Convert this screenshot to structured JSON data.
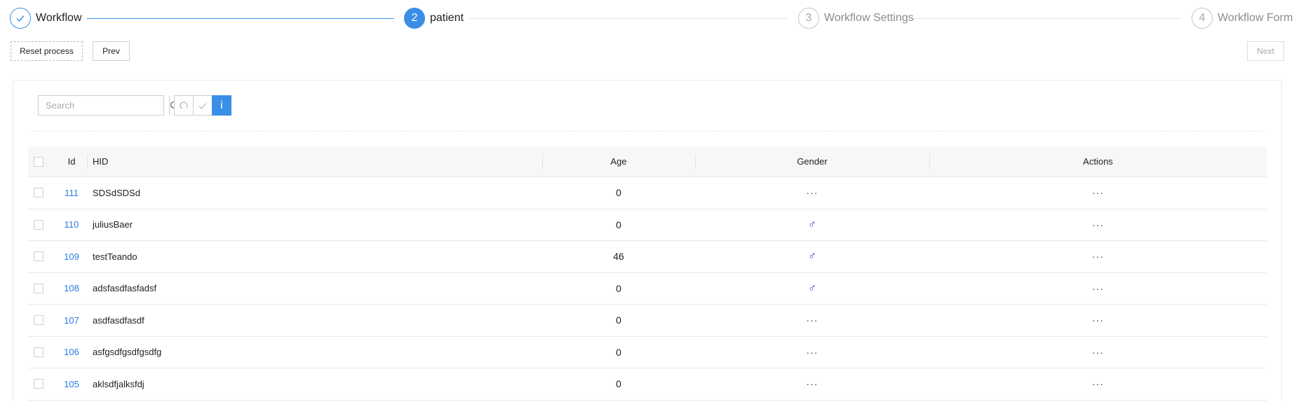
{
  "steps": [
    {
      "index": "1",
      "title": "Workflow",
      "status": "done"
    },
    {
      "index": "2",
      "title": "patient",
      "status": "active"
    },
    {
      "index": "3",
      "title": "Workflow Settings",
      "status": "wait"
    },
    {
      "index": "4",
      "title": "Workflow Form",
      "status": "wait"
    }
  ],
  "buttons": {
    "reset": "Reset process",
    "prev": "Prev",
    "next": "Next"
  },
  "search": {
    "placeholder": "Search"
  },
  "toolbar": {
    "info_label": "i"
  },
  "table": {
    "headers": {
      "id": "Id",
      "hid": "HID",
      "age": "Age",
      "gender": "Gender",
      "actions": "Actions"
    },
    "rows": [
      {
        "id": "111",
        "hid": "SDSdSDSd",
        "age": "0",
        "gender": "···",
        "actions": "···"
      },
      {
        "id": "110",
        "hid": "juliusBaer",
        "age": "0",
        "gender": "♂",
        "actions": "···"
      },
      {
        "id": "109",
        "hid": "testTeando",
        "age": "46",
        "gender": "♂",
        "actions": "···"
      },
      {
        "id": "108",
        "hid": "adsfasdfasfadsf",
        "age": "0",
        "gender": "♂",
        "actions": "···"
      },
      {
        "id": "107",
        "hid": "asdfasdfasdf",
        "age": "0",
        "gender": "···",
        "actions": "···"
      },
      {
        "id": "106",
        "hid": "asfgsdfgsdfgsdfg",
        "age": "0",
        "gender": "···",
        "actions": "···"
      },
      {
        "id": "105",
        "hid": "aklsdfjalksfdj",
        "age": "0",
        "gender": "···",
        "actions": "···"
      }
    ]
  },
  "colors": {
    "accent": "#3a8ee6",
    "link": "#2b7be0",
    "male": "#1a3fd0"
  }
}
